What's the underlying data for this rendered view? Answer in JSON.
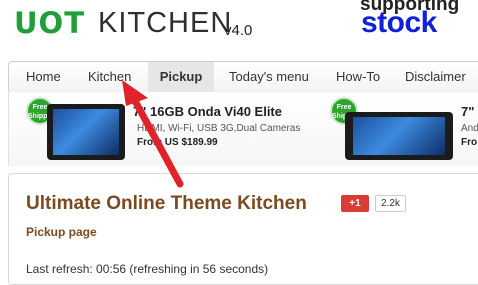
{
  "header": {
    "logo_part1": "UOT",
    "logo_part2": "KITCHEN",
    "version": "v4.0"
  },
  "ad": {
    "line1": "supporting",
    "line2": "stock"
  },
  "nav": {
    "items": [
      {
        "label": "Home"
      },
      {
        "label": "Kitchen"
      },
      {
        "label": "Pickup"
      },
      {
        "label": "Today's menu"
      },
      {
        "label": "How-To"
      },
      {
        "label": "Disclaimer"
      }
    ],
    "active": "Pickup"
  },
  "banner": {
    "badge_text": "Free Shipping",
    "product1": {
      "title": "7\" 16GB Onda Vi40 Elite",
      "desc": "HDMI, Wi-Fi, USB 3G,Dual Cameras",
      "price": "From US $189.99"
    },
    "product2": {
      "title": "7\"",
      "desc": "And",
      "price": "Fro"
    }
  },
  "content": {
    "title": "Ultimate Online Theme Kitchen",
    "gplus_label": "+1",
    "gplus_count": "2.2k",
    "subtitle": "Pickup page",
    "refresh_text": "Last refresh: 00:56 (refreshing in 56 seconds)"
  },
  "colors": {
    "logo_green": "#1f9e3a",
    "stock_blue": "#1020d8",
    "title_brown": "#7a4a22",
    "gplus_red": "#d73d32",
    "arrow_red": "#e0232b"
  }
}
